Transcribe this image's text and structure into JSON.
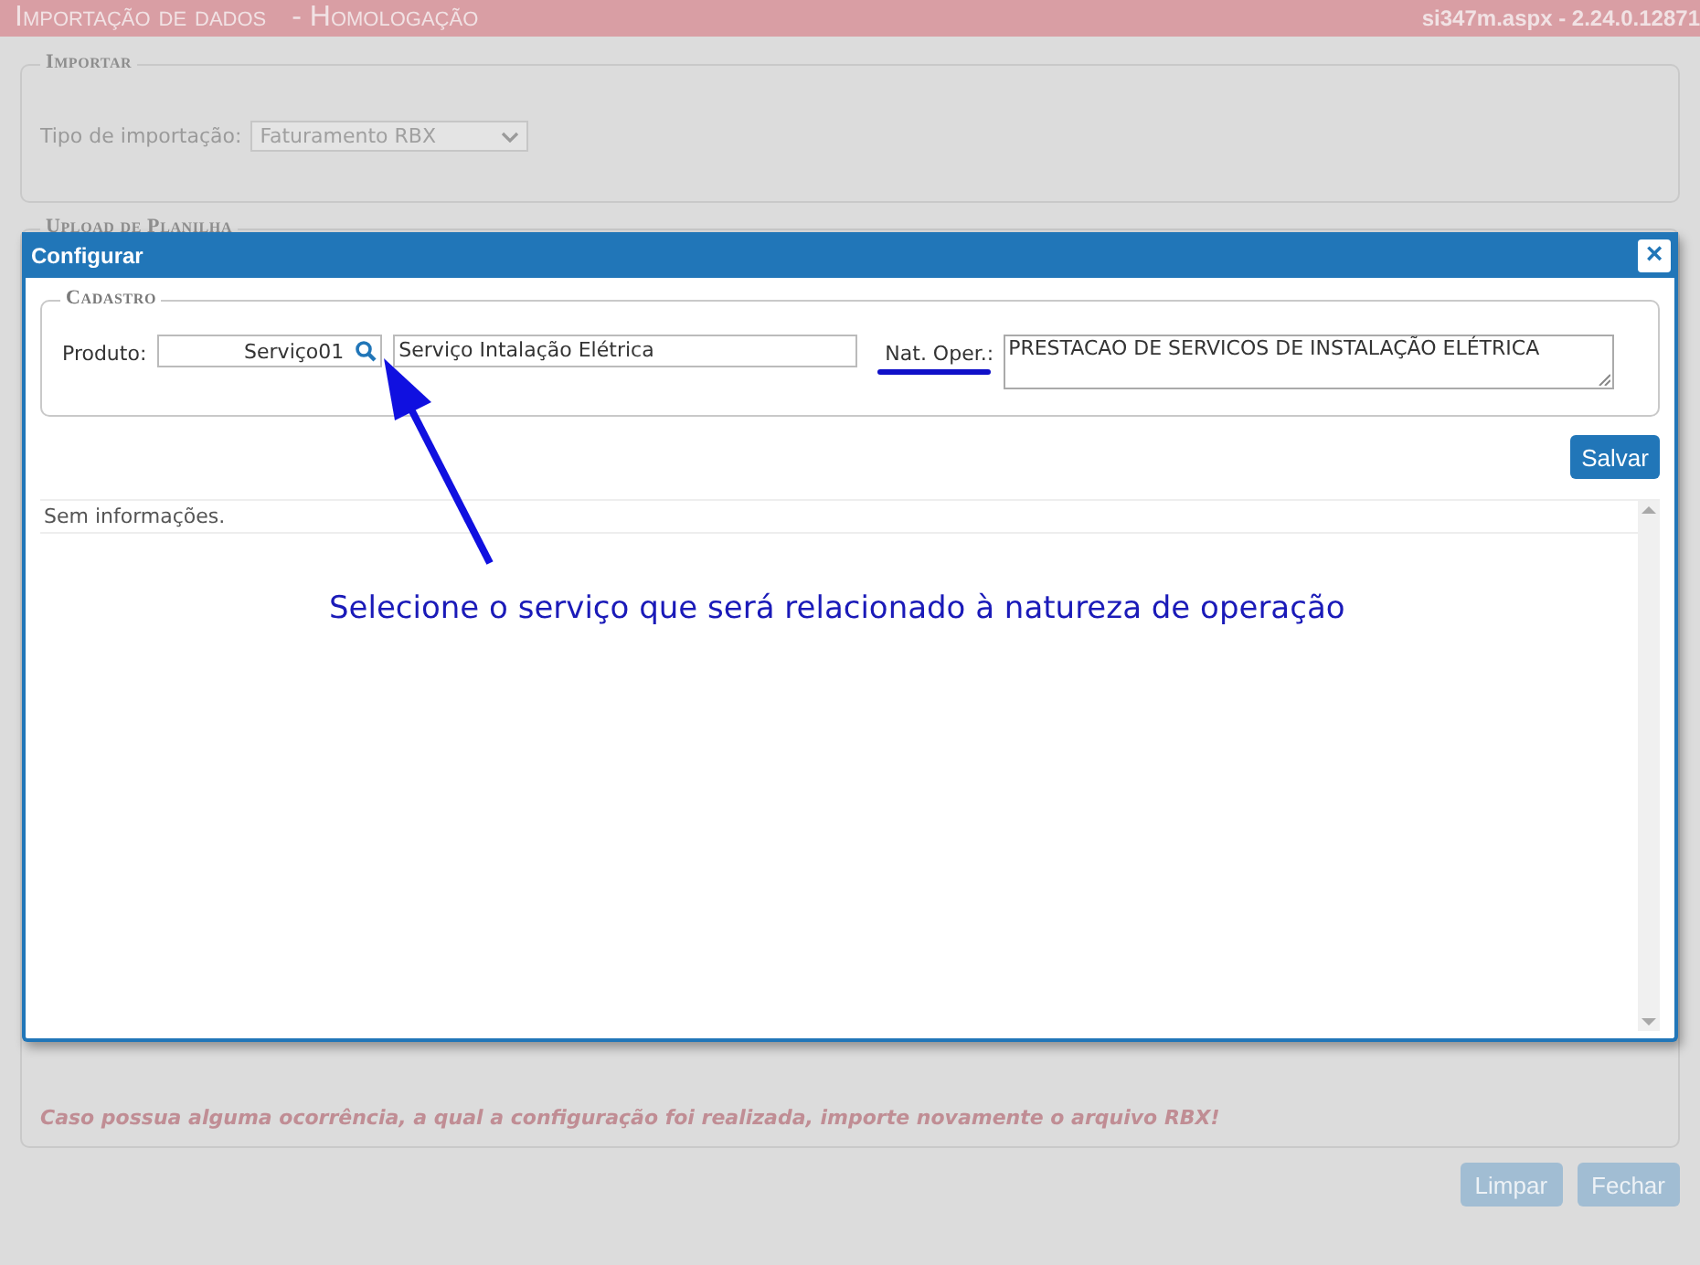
{
  "header": {
    "title": "Importação de dados",
    "subtitle": "- Homologação",
    "version": "si347m.aspx - 2.24.0.12871"
  },
  "importar": {
    "legend": "Importar",
    "label": "Tipo de importação:",
    "value": "Faturamento RBX"
  },
  "upload": {
    "legend": "Upload de Planilha",
    "note": "Caso possua alguma ocorrência, a qual a configuração foi realizada, importe novamente o arquivo RBX!"
  },
  "buttons": [
    {
      "label": "Limpar",
      "disabled": true
    },
    {
      "label": "Fechar",
      "disabled": true
    }
  ],
  "dialog": {
    "title": "Configurar",
    "close": "×",
    "legend": "Cadastro",
    "produto_label": "Produto:",
    "produto_code": "Serviço01",
    "produto_name": "Serviço Intalação Elétrica",
    "natureza_label": "Nat. Oper.:",
    "natureza_value": "PRESTACAO DE SERVICOS DE INSTALAÇÃO ELÉTRICA",
    "save": "Salvar",
    "empty_message": "Sem informações."
  },
  "annotation": {
    "text": "Selecione o serviço que será relacionado à natureza de operação"
  }
}
